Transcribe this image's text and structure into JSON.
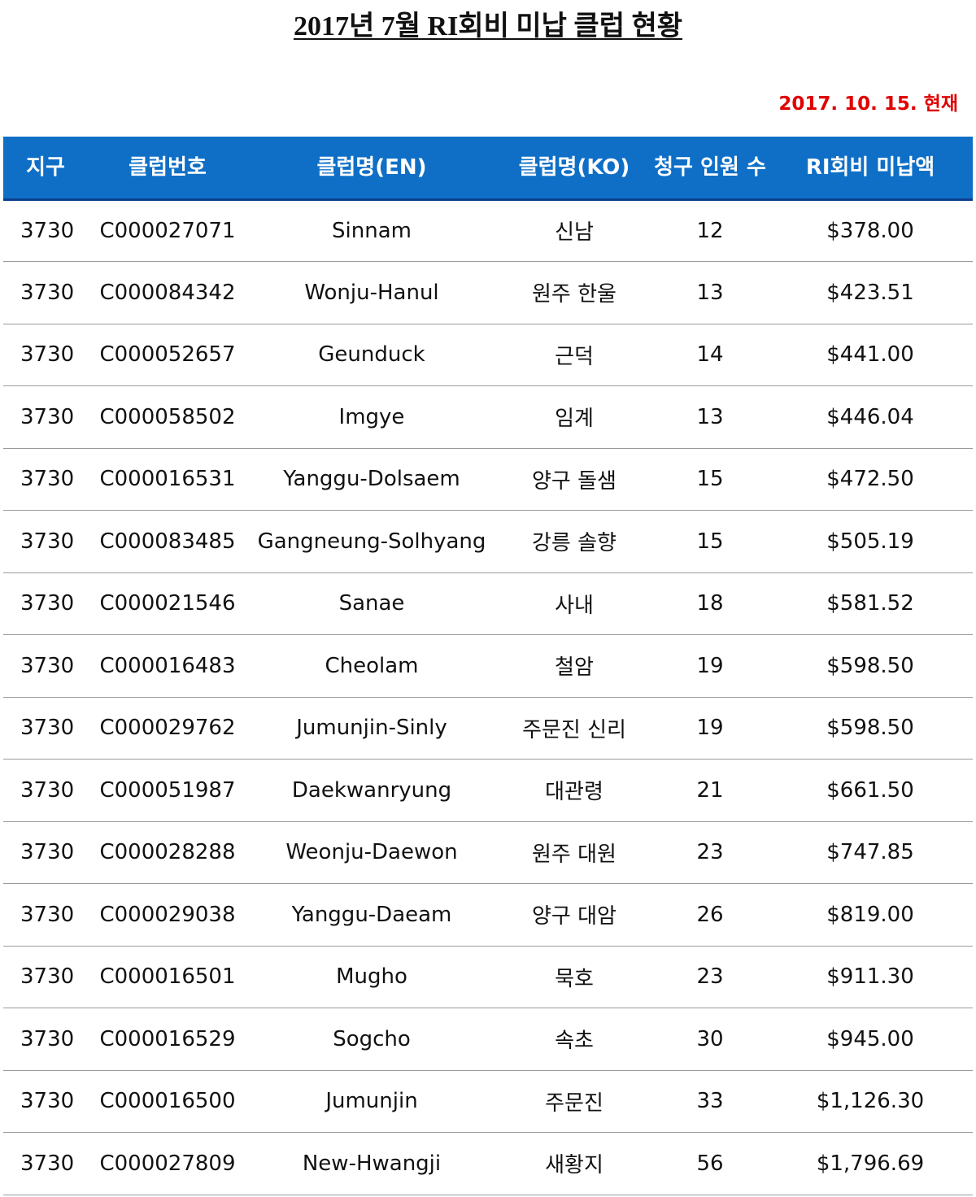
{
  "title": "2017년 7월 RI회비 미납 클럽 현황",
  "as_of": "2017. 10. 15. 현재",
  "colors": {
    "header_bg": "#0f6fc6",
    "header_text": "#ffffff",
    "as_of_text": "#e00000",
    "row_divider": "#9a9a9a"
  },
  "table": {
    "headers": {
      "district": "지구",
      "club_no": "클럽번호",
      "club_en": "클럽명(EN)",
      "club_ko": "클럽명(KO)",
      "billed": "청구 인원 수",
      "dues": "RI회비 미납액"
    },
    "rows": [
      {
        "district": "3730",
        "club_no": "C000027071",
        "club_en": "Sinnam",
        "club_ko": "신남",
        "billed": "12",
        "dues": "$378.00"
      },
      {
        "district": "3730",
        "club_no": "C000084342",
        "club_en": "Wonju-Hanul",
        "club_ko": "원주 한울",
        "billed": "13",
        "dues": "$423.51"
      },
      {
        "district": "3730",
        "club_no": "C000052657",
        "club_en": "Geunduck",
        "club_ko": "근덕",
        "billed": "14",
        "dues": "$441.00"
      },
      {
        "district": "3730",
        "club_no": "C000058502",
        "club_en": "Imgye",
        "club_ko": "임계",
        "billed": "13",
        "dues": "$446.04"
      },
      {
        "district": "3730",
        "club_no": "C000016531",
        "club_en": "Yanggu-Dolsaem",
        "club_ko": "양구 돌샘",
        "billed": "15",
        "dues": "$472.50"
      },
      {
        "district": "3730",
        "club_no": "C000083485",
        "club_en": "Gangneung-Solhyang",
        "club_ko": "강릉 솔향",
        "billed": "15",
        "dues": "$505.19"
      },
      {
        "district": "3730",
        "club_no": "C000021546",
        "club_en": "Sanae",
        "club_ko": "사내",
        "billed": "18",
        "dues": "$581.52"
      },
      {
        "district": "3730",
        "club_no": "C000016483",
        "club_en": "Cheolam",
        "club_ko": "철암",
        "billed": "19",
        "dues": "$598.50"
      },
      {
        "district": "3730",
        "club_no": "C000029762",
        "club_en": "Jumunjin-Sinly",
        "club_ko": "주문진 신리",
        "billed": "19",
        "dues": "$598.50"
      },
      {
        "district": "3730",
        "club_no": "C000051987",
        "club_en": "Daekwanryung",
        "club_ko": "대관령",
        "billed": "21",
        "dues": "$661.50"
      },
      {
        "district": "3730",
        "club_no": "C000028288",
        "club_en": "Weonju-Daewon",
        "club_ko": "원주 대원",
        "billed": "23",
        "dues": "$747.85"
      },
      {
        "district": "3730",
        "club_no": "C000029038",
        "club_en": "Yanggu-Daeam",
        "club_ko": "양구 대암",
        "billed": "26",
        "dues": "$819.00"
      },
      {
        "district": "3730",
        "club_no": "C000016501",
        "club_en": "Mugho",
        "club_ko": "묵호",
        "billed": "23",
        "dues": "$911.30"
      },
      {
        "district": "3730",
        "club_no": "C000016529",
        "club_en": "Sogcho",
        "club_ko": "속초",
        "billed": "30",
        "dues": "$945.00"
      },
      {
        "district": "3730",
        "club_no": "C000016500",
        "club_en": "Jumunjin",
        "club_ko": "주문진",
        "billed": "33",
        "dues": "$1,126.30"
      },
      {
        "district": "3730",
        "club_no": "C000027809",
        "club_en": "New-Hwangji",
        "club_ko": "새황지",
        "billed": "56",
        "dues": "$1,796.69"
      }
    ]
  }
}
